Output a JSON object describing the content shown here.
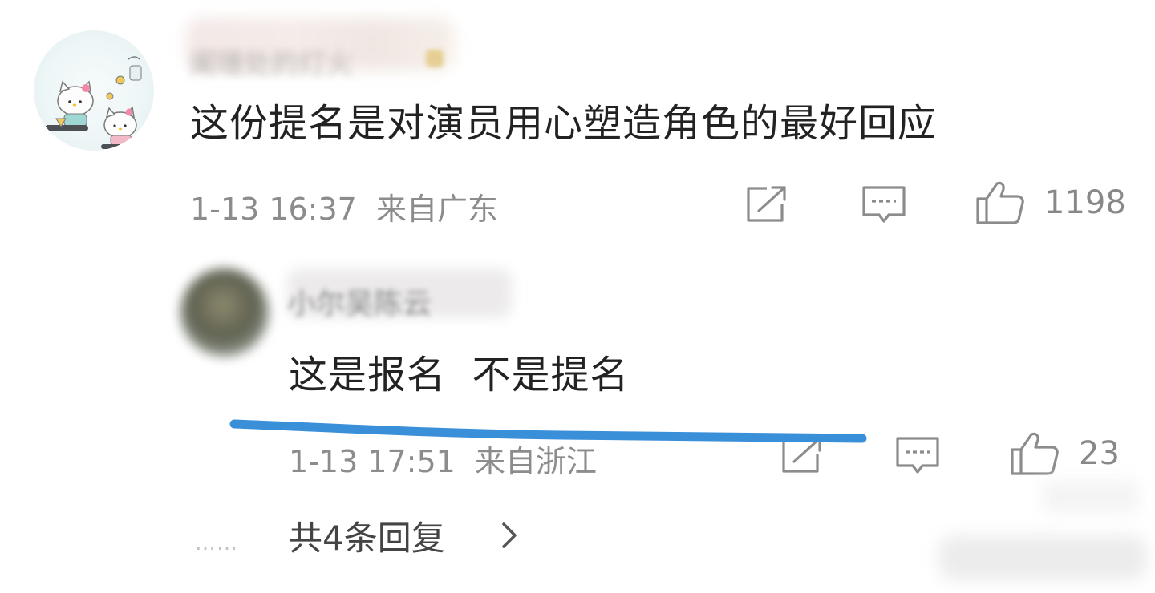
{
  "main_comment": {
    "username": "阑珊处的灯火",
    "text": "这份提名是对演员用心塑造角色的最好回应",
    "timestamp": "1-13 16:37",
    "location": "来自广东",
    "like_count": "1198",
    "icons": [
      "share-icon",
      "comment-icon",
      "like-icon"
    ]
  },
  "reply": {
    "username": "小尔吴陈云",
    "text": "这是报名  不是提名",
    "timestamp": "1-13 17:51",
    "location": "来自浙江",
    "like_count": "23",
    "icons": [
      "share-icon",
      "comment-icon",
      "like-icon"
    ]
  },
  "replies_link": {
    "dots": "……",
    "label": "共4条回复"
  },
  "colors": {
    "text": "#222222",
    "meta": "#8c8c8c",
    "annotation": "#3a8fd9"
  }
}
